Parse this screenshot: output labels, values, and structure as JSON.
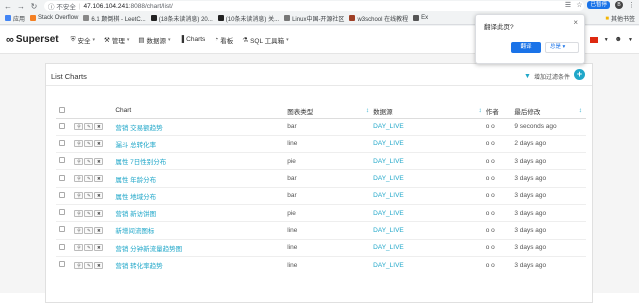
{
  "browser": {
    "url_security": "不安全",
    "url_host": "47.106.104.241",
    "url_path": ":8088/chart/list/",
    "paused_label": "已暂停",
    "avatar_letter": "B",
    "bookmarks": [
      {
        "label": "应用",
        "color": "#4285f4"
      },
      {
        "label": "Stack Overflow",
        "color": "#f48024"
      },
      {
        "label": "6.1 颠倒棋 - LeetC...",
        "color": "#888888"
      },
      {
        "label": "(18条未读消息) 20...",
        "color": "#222222"
      },
      {
        "label": "(10条未读消息) 关...",
        "color": "#222222"
      },
      {
        "label": "Linux中国-开源社区",
        "color": "#777777"
      },
      {
        "label": "w3school 在线教程",
        "color": "#9e3f26"
      },
      {
        "label": "Ex",
        "color": "#555555"
      }
    ],
    "bookmarks_more": "其他书签"
  },
  "navbar": {
    "brand": "Superset",
    "menu": [
      {
        "label": "安全",
        "icon": "security-icon",
        "has_caret": true
      },
      {
        "label": "管理",
        "icon": "wrench-icon",
        "has_caret": true
      },
      {
        "label": "数据源",
        "icon": "database-icon",
        "has_caret": true
      },
      {
        "label": "Charts",
        "icon": "bar-chart-icon",
        "has_caret": false
      },
      {
        "label": "看板",
        "icon": "dashboard-icon",
        "has_caret": false
      },
      {
        "label": "SQL 工具箱",
        "icon": "flask-icon",
        "has_caret": true
      }
    ]
  },
  "translate_popup": {
    "title": "翻译此页?",
    "translate_label": "翻译",
    "decline_label": "总是"
  },
  "list": {
    "title": "List Charts",
    "filter_label": "增加过滤条件",
    "columns": {
      "chart": "Chart",
      "type": "图表类型",
      "datasource": "数据源",
      "author": "作者",
      "modified": "最后修改"
    },
    "rows": [
      {
        "name": "营销 交易额趋势",
        "type": "bar",
        "ds": "DAY_LIVE",
        "author": "o o",
        "modified": "9 seconds ago"
      },
      {
        "name": "漏斗 总转化率",
        "type": "line",
        "ds": "DAY_LIVE",
        "author": "o o",
        "modified": "2 days ago"
      },
      {
        "name": "属性 7日性别分布",
        "type": "pie",
        "ds": "DAY_LIVE",
        "author": "o o",
        "modified": "3 days ago"
      },
      {
        "name": "属性 年龄分布",
        "type": "bar",
        "ds": "DAY_LIVE",
        "author": "o o",
        "modified": "3 days ago"
      },
      {
        "name": "属性 地域分布",
        "type": "bar",
        "ds": "DAY_LIVE",
        "author": "o o",
        "modified": "3 days ago"
      },
      {
        "name": "营销 新访饼图",
        "type": "pie",
        "ds": "DAY_LIVE",
        "author": "o o",
        "modified": "3 days ago"
      },
      {
        "name": "新增间流图标",
        "type": "line",
        "ds": "DAY_LIVE",
        "author": "o o",
        "modified": "3 days ago"
      },
      {
        "name": "营销 分钟新流量趋势图",
        "type": "line",
        "ds": "DAY_LIVE",
        "author": "o o",
        "modified": "3 days ago"
      },
      {
        "name": "营销 转化率趋势",
        "type": "line",
        "ds": "DAY_LIVE",
        "author": "o o",
        "modified": "3 days ago"
      }
    ]
  },
  "colors": {
    "accent": "#20a7c9",
    "chrome_blue": "#1a73e8"
  }
}
